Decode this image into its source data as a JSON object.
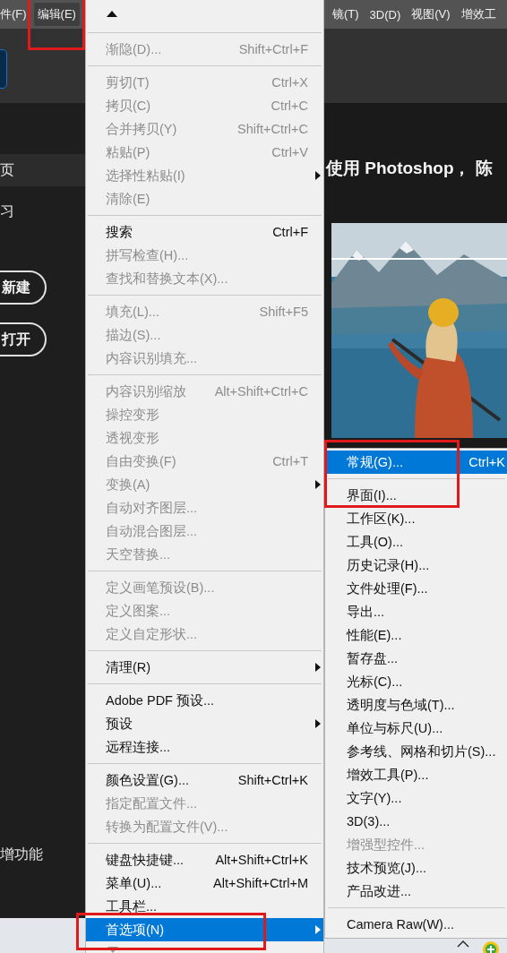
{
  "menubar": {
    "left_items": [
      {
        "label": "件(F)",
        "selected": false
      },
      {
        "label": "编辑(E)",
        "selected": true
      }
    ],
    "right_items": [
      {
        "label": "镜(T)",
        "selected": false
      },
      {
        "label": "3D(D)",
        "selected": false
      },
      {
        "label": "视图(V)",
        "selected": false
      },
      {
        "label": "增效工",
        "selected": false
      }
    ]
  },
  "sidebar": {
    "items": [
      {
        "label": "页",
        "selected": true
      },
      {
        "label": "习",
        "selected": false
      }
    ],
    "buttons": [
      "新建",
      "打开"
    ],
    "footer": "增功能"
  },
  "main": {
    "heading": "使用 Photoshop， 陈"
  },
  "edit_menu": {
    "groups": [
      [
        {
          "label": "渐隐(D)...",
          "shortcut": "Shift+Ctrl+F",
          "disabled": true,
          "submenu": false,
          "selected": false
        }
      ],
      [
        {
          "label": "剪切(T)",
          "shortcut": "Ctrl+X",
          "disabled": true,
          "submenu": false,
          "selected": false
        },
        {
          "label": "拷贝(C)",
          "shortcut": "Ctrl+C",
          "disabled": true,
          "submenu": false,
          "selected": false
        },
        {
          "label": "合并拷贝(Y)",
          "shortcut": "Shift+Ctrl+C",
          "disabled": true,
          "submenu": false,
          "selected": false
        },
        {
          "label": "粘贴(P)",
          "shortcut": "Ctrl+V",
          "disabled": true,
          "submenu": false,
          "selected": false
        },
        {
          "label": "选择性粘贴(I)",
          "disabled": true,
          "submenu": true,
          "selected": false
        },
        {
          "label": "清除(E)",
          "disabled": true,
          "submenu": false,
          "selected": false
        }
      ],
      [
        {
          "label": "搜索",
          "shortcut": "Ctrl+F",
          "disabled": false,
          "submenu": false,
          "selected": false
        },
        {
          "label": "拼写检查(H)...",
          "disabled": true,
          "submenu": false,
          "selected": false
        },
        {
          "label": "查找和替换文本(X)...",
          "disabled": true,
          "submenu": false,
          "selected": false
        }
      ],
      [
        {
          "label": "填充(L)...",
          "shortcut": "Shift+F5",
          "disabled": true,
          "submenu": false,
          "selected": false
        },
        {
          "label": "描边(S)...",
          "disabled": true,
          "submenu": false,
          "selected": false
        },
        {
          "label": "内容识别填充...",
          "disabled": true,
          "submenu": false,
          "selected": false
        }
      ],
      [
        {
          "label": "内容识别缩放",
          "shortcut": "Alt+Shift+Ctrl+C",
          "disabled": true,
          "submenu": false,
          "selected": false
        },
        {
          "label": "操控变形",
          "disabled": true,
          "submenu": false,
          "selected": false
        },
        {
          "label": "透视变形",
          "disabled": true,
          "submenu": false,
          "selected": false
        },
        {
          "label": "自由变换(F)",
          "shortcut": "Ctrl+T",
          "disabled": true,
          "submenu": false,
          "selected": false
        },
        {
          "label": "变换(A)",
          "disabled": true,
          "submenu": true,
          "selected": false
        },
        {
          "label": "自动对齐图层...",
          "disabled": true,
          "submenu": false,
          "selected": false
        },
        {
          "label": "自动混合图层...",
          "disabled": true,
          "submenu": false,
          "selected": false
        },
        {
          "label": "天空替换...",
          "disabled": true,
          "submenu": false,
          "selected": false
        }
      ],
      [
        {
          "label": "定义画笔预设(B)...",
          "disabled": true,
          "submenu": false,
          "selected": false
        },
        {
          "label": "定义图案...",
          "disabled": true,
          "submenu": false,
          "selected": false
        },
        {
          "label": "定义自定形状...",
          "disabled": true,
          "submenu": false,
          "selected": false
        }
      ],
      [
        {
          "label": "清理(R)",
          "disabled": false,
          "submenu": true,
          "selected": false
        }
      ],
      [
        {
          "label": "Adobe PDF 预设...",
          "disabled": false,
          "submenu": false,
          "selected": false
        },
        {
          "label": "预设",
          "disabled": false,
          "submenu": true,
          "selected": false
        },
        {
          "label": "远程连接...",
          "disabled": false,
          "submenu": false,
          "selected": false
        }
      ],
      [
        {
          "label": "颜色设置(G)...",
          "shortcut": "Shift+Ctrl+K",
          "disabled": false,
          "submenu": false,
          "selected": false
        },
        {
          "label": "指定配置文件...",
          "disabled": true,
          "submenu": false,
          "selected": false
        },
        {
          "label": "转换为配置文件(V)...",
          "disabled": true,
          "submenu": false,
          "selected": false
        }
      ],
      [
        {
          "label": "键盘快捷键...",
          "shortcut": "Alt+Shift+Ctrl+K",
          "disabled": false,
          "submenu": false,
          "selected": false
        },
        {
          "label": "菜单(U)...",
          "shortcut": "Alt+Shift+Ctrl+M",
          "disabled": false,
          "submenu": false,
          "selected": false
        },
        {
          "label": "工具栏...",
          "disabled": false,
          "submenu": false,
          "selected": false
        },
        {
          "label": "首选项(N)",
          "disabled": false,
          "submenu": true,
          "selected": true
        }
      ]
    ]
  },
  "preferences_submenu": {
    "groups": [
      [
        {
          "label": "常规(G)...",
          "shortcut": "Ctrl+K",
          "disabled": false,
          "selected": true
        }
      ],
      [
        {
          "label": "界面(I)...",
          "disabled": false,
          "selected": false
        },
        {
          "label": "工作区(K)...",
          "disabled": false,
          "selected": false
        },
        {
          "label": "工具(O)...",
          "disabled": false,
          "selected": false
        },
        {
          "label": "历史记录(H)...",
          "disabled": false,
          "selected": false
        },
        {
          "label": "文件处理(F)...",
          "disabled": false,
          "selected": false
        },
        {
          "label": "导出...",
          "disabled": false,
          "selected": false
        },
        {
          "label": "性能(E)...",
          "disabled": false,
          "selected": false
        },
        {
          "label": "暂存盘...",
          "disabled": false,
          "selected": false
        },
        {
          "label": "光标(C)...",
          "disabled": false,
          "selected": false
        },
        {
          "label": "透明度与色域(T)...",
          "disabled": false,
          "selected": false
        },
        {
          "label": "单位与标尺(U)...",
          "disabled": false,
          "selected": false
        },
        {
          "label": "参考线、网格和切片(S)...",
          "disabled": false,
          "selected": false
        },
        {
          "label": "增效工具(P)...",
          "disabled": false,
          "selected": false
        },
        {
          "label": "文字(Y)...",
          "disabled": false,
          "selected": false
        },
        {
          "label": "3D(3)...",
          "disabled": false,
          "selected": false
        },
        {
          "label": "增强型控件...",
          "disabled": true,
          "selected": false
        },
        {
          "label": "技术预览(J)...",
          "disabled": false,
          "selected": false
        },
        {
          "label": "产品改进...",
          "disabled": false,
          "selected": false
        }
      ],
      [
        {
          "label": "Camera Raw(W)...",
          "disabled": false,
          "selected": false
        }
      ]
    ]
  }
}
